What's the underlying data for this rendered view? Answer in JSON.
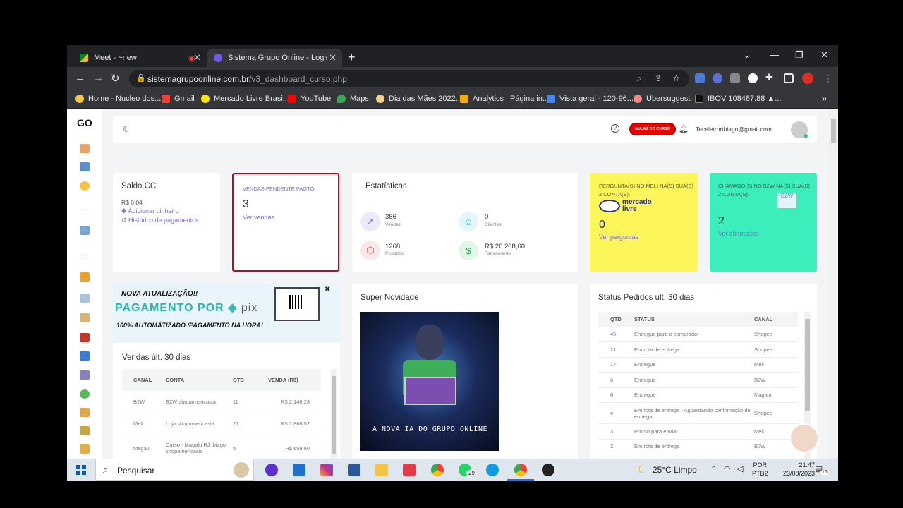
{
  "browser": {
    "tabs": [
      {
        "title": "Meet - ~new"
      },
      {
        "title": "Sistema Grupo Online - Login: te"
      }
    ],
    "url_host": "sistemagrupoonline.com.br",
    "url_path": "/v3_dashboard_curso.php",
    "bookmarks": [
      "Home - Nucleo dos...",
      "Gmail",
      "Mercado Livre Brasi...",
      "YouTube",
      "Maps",
      "Dia das Mães 2022...",
      "Analytics | Página in...",
      "Vista geral - 120-96...",
      "Ubersuggest",
      "IBOV 108487.88 ▲..."
    ]
  },
  "app": {
    "logo": "GO",
    "header": {
      "aulas_button": "AULAS DO CURSO",
      "user_email": "Teceletrorthiago@gmail.com"
    },
    "saldo": {
      "title": "Saldo CC",
      "value": "R$ 0,04",
      "add_link": "Adicionar dinheiro",
      "history_link": "Histórico de pagamentos"
    },
    "vendas_pendente": {
      "title": "VENDAS PENDENTE PAGTO",
      "count": "3",
      "link": "Ver vendas"
    },
    "estatisticas": {
      "title": "Estatísticas",
      "items": [
        {
          "value": "386",
          "label": "Vendas"
        },
        {
          "value": "0",
          "label": "Clientes"
        },
        {
          "value": "1268",
          "label": "Produtos"
        },
        {
          "value": "R$ 26.208,60",
          "label": "Faturamento"
        }
      ]
    },
    "perguntas": {
      "title": "PERGUNTA(S) NO MELI NA(S) SUA(S) 2 CONTA(S).",
      "logo_text_1": "mercado",
      "logo_text_2": "livre",
      "count": "0",
      "link": "Ver perguntas"
    },
    "chamados": {
      "title": "CHAMADO(S) NO B2W NA(S) SUA(S) 2 CONTA(S).",
      "logo_text": "B2W",
      "count": "2",
      "link": "Ver chamados"
    },
    "banner": {
      "line1": "NOVA ATUALIZAÇÃO!!",
      "line2": "PAGAMENTO POR",
      "pix": "pix",
      "line3": "100% AUTOMÁTIZADO /PAGAMENTO NA HORA!"
    },
    "vendas30": {
      "title": "Vendas últ. 30 dias",
      "headers": [
        "CANAL",
        "CONTA",
        "QTD",
        "VENDA (R$)"
      ],
      "rows": [
        [
          "B2W",
          "B2W shopamericasia",
          "11",
          "R$ 2.146,28"
        ],
        [
          "Meli",
          "Loja shopamericasia",
          "21",
          "R$ 1.868,52"
        ],
        [
          "Magalu",
          "Curso - Magalu RJ thiago shopamericasia",
          "5",
          "R$ 658,60"
        ]
      ]
    },
    "novidade": {
      "title": "Super Novidade",
      "caption": "A NOVA IA DO GRUPO ONLINE"
    },
    "status": {
      "title": "Status Pedidos últ. 30 dias",
      "headers": [
        "QTD",
        "STATUS",
        "CANAL"
      ],
      "rows": [
        [
          "45",
          "Entregue para o comprador",
          "Shopee"
        ],
        [
          "21",
          "Em rota de entrega",
          "Shopee"
        ],
        [
          "17",
          "Entregue",
          "Meli"
        ],
        [
          "6",
          "Entregue",
          "B2W"
        ],
        [
          "6",
          "Entregue",
          "Magalu"
        ],
        [
          "4",
          "Em rota de entrega - Aguardando confirmação de entrega",
          "Shopee"
        ],
        [
          "3",
          "Pronto para enviar",
          "Meli"
        ],
        [
          "3",
          "Em rota de entrega",
          "B2W"
        ]
      ]
    }
  },
  "taskbar": {
    "search": "Pesquisar",
    "whatsapp_badge": "29",
    "weather": "25°C  Limpo",
    "lang1": "POR",
    "lang2": "PTB2",
    "time": "21:47",
    "date": "23/08/2023",
    "notif": "16"
  },
  "colors": {
    "accent": "#7b6fd1",
    "yellow": "#fdf65a",
    "teal": "#3ceebb",
    "red_border": "#d0021b"
  }
}
